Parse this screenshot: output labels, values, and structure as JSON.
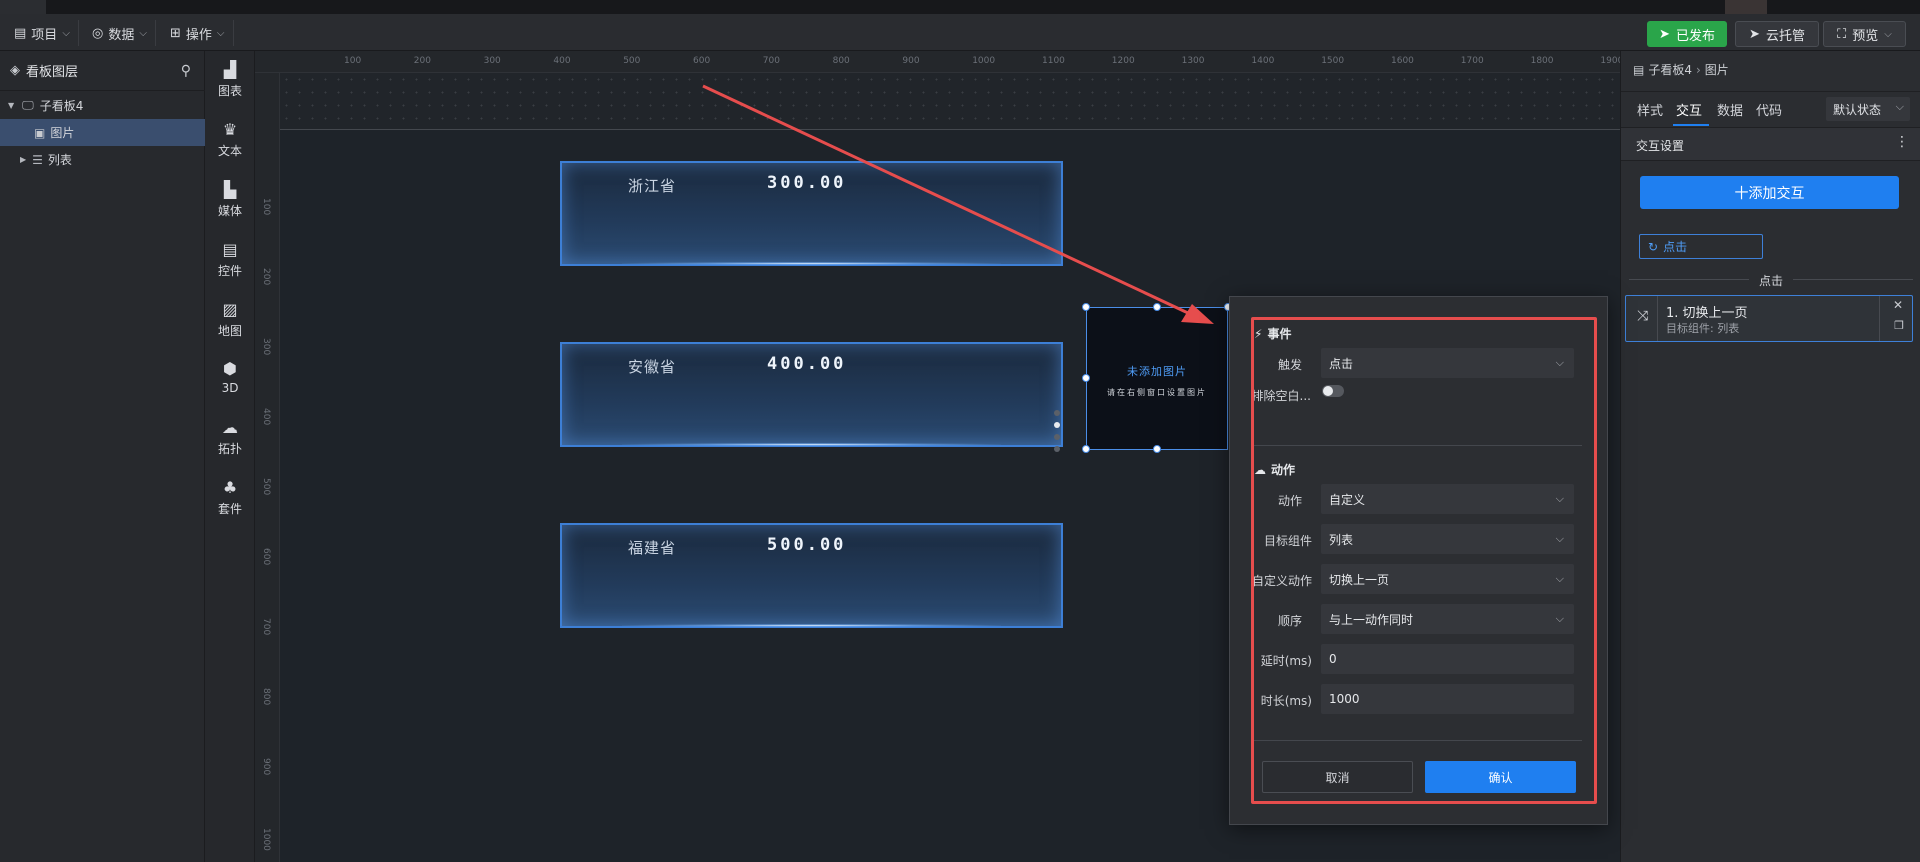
{
  "toolbar": {
    "project": "项目",
    "data": "数据",
    "operate": "操作",
    "published": "已发布",
    "cloud": "云托管",
    "preview": "预览"
  },
  "layers": {
    "title": "看板图层",
    "items": [
      {
        "label": "子看板4"
      },
      {
        "label": "图片"
      },
      {
        "label": "列表"
      }
    ]
  },
  "icon_column": [
    {
      "label": "图表",
      "icon": "chart-icon"
    },
    {
      "label": "文本",
      "icon": "text-icon"
    },
    {
      "label": "媒体",
      "icon": "media-icon"
    },
    {
      "label": "控件",
      "icon": "control-icon"
    },
    {
      "label": "地图",
      "icon": "map-icon"
    },
    {
      "label": "3D",
      "icon": "cube-icon"
    },
    {
      "label": "拓扑",
      "icon": "topology-icon"
    },
    {
      "label": "套件",
      "icon": "kit-icon"
    }
  ],
  "ruler": {
    "top": [
      "100",
      "200",
      "300",
      "400",
      "500",
      "600",
      "700",
      "800",
      "900",
      "1000",
      "1100",
      "1200",
      "1300",
      "1400",
      "1500",
      "1600",
      "1700",
      "1800",
      "1900"
    ],
    "left": [
      "100",
      "200",
      "300",
      "400",
      "500",
      "600",
      "700",
      "800",
      "900",
      "1000"
    ]
  },
  "cards": [
    {
      "province": "浙江省",
      "value": "300.00"
    },
    {
      "province": "安徽省",
      "value": "400.00"
    },
    {
      "province": "福建省",
      "value": "500.00"
    }
  ],
  "image_placeholder": {
    "title": "未添加图片",
    "hint": "请在右侧窗口设置图片"
  },
  "right_panel": {
    "breadcrumb_parent": "子看板4",
    "breadcrumb_current": "图片",
    "tabs": [
      "样式",
      "交互",
      "数据",
      "代码"
    ],
    "state_select": "默认状态",
    "section_title": "交互设置",
    "add_button": "十添加交互",
    "event_chip": "点击",
    "divider_label": "点击",
    "action_item_title": "1. 切换上一页",
    "action_item_sub": "目标组件: 列表"
  },
  "dialog": {
    "event_title": "事件",
    "trigger_label": "触发",
    "trigger_value": "点击",
    "exclude_label": "排除空白...",
    "action_title": "动作",
    "action_label": "动作",
    "action_value": "自定义",
    "target_label": "目标组件",
    "target_value": "列表",
    "custom_label": "自定义动作",
    "custom_value": "切换上一页",
    "order_label": "顺序",
    "order_value": "与上一动作同时",
    "delay_label": "延时(ms)",
    "delay_value": "0",
    "duration_label": "时长(ms)",
    "duration_value": "1000",
    "cancel": "取消",
    "confirm": "确认"
  },
  "colors": {
    "accent": "#1f7ff0",
    "publish": "#2aa54a",
    "annotation": "#e64d4d"
  }
}
